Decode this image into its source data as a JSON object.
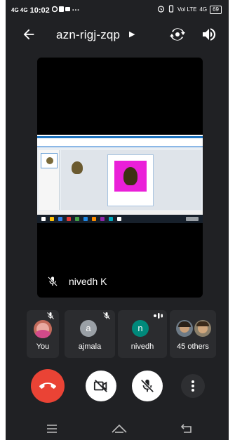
{
  "status_bar": {
    "network": "4G 4G",
    "time": "10:02",
    "more": "···",
    "volte": "Vol LTE",
    "signal": "4G",
    "battery": "69"
  },
  "header": {
    "meeting_code": "azn-rigj-zqp"
  },
  "main_tile": {
    "participant_name": "nivedh K"
  },
  "participants": [
    {
      "label": "You"
    },
    {
      "label": "ajmala",
      "initial": "a",
      "color": "#9aa0a6"
    },
    {
      "label": "nivedh",
      "initial": "n",
      "color": "#00897b"
    },
    {
      "label": "45 others"
    }
  ],
  "colors": {
    "background": "#202124",
    "end_call": "#ea4335",
    "card": "#2b2c2f"
  },
  "icons": [
    "back-arrow-icon",
    "chevron-right-icon",
    "switch-camera-icon",
    "speaker-icon",
    "mic-off-icon",
    "end-call-icon",
    "camera-off-icon",
    "more-vert-icon",
    "menu-icon",
    "home-icon",
    "back-icon"
  ]
}
